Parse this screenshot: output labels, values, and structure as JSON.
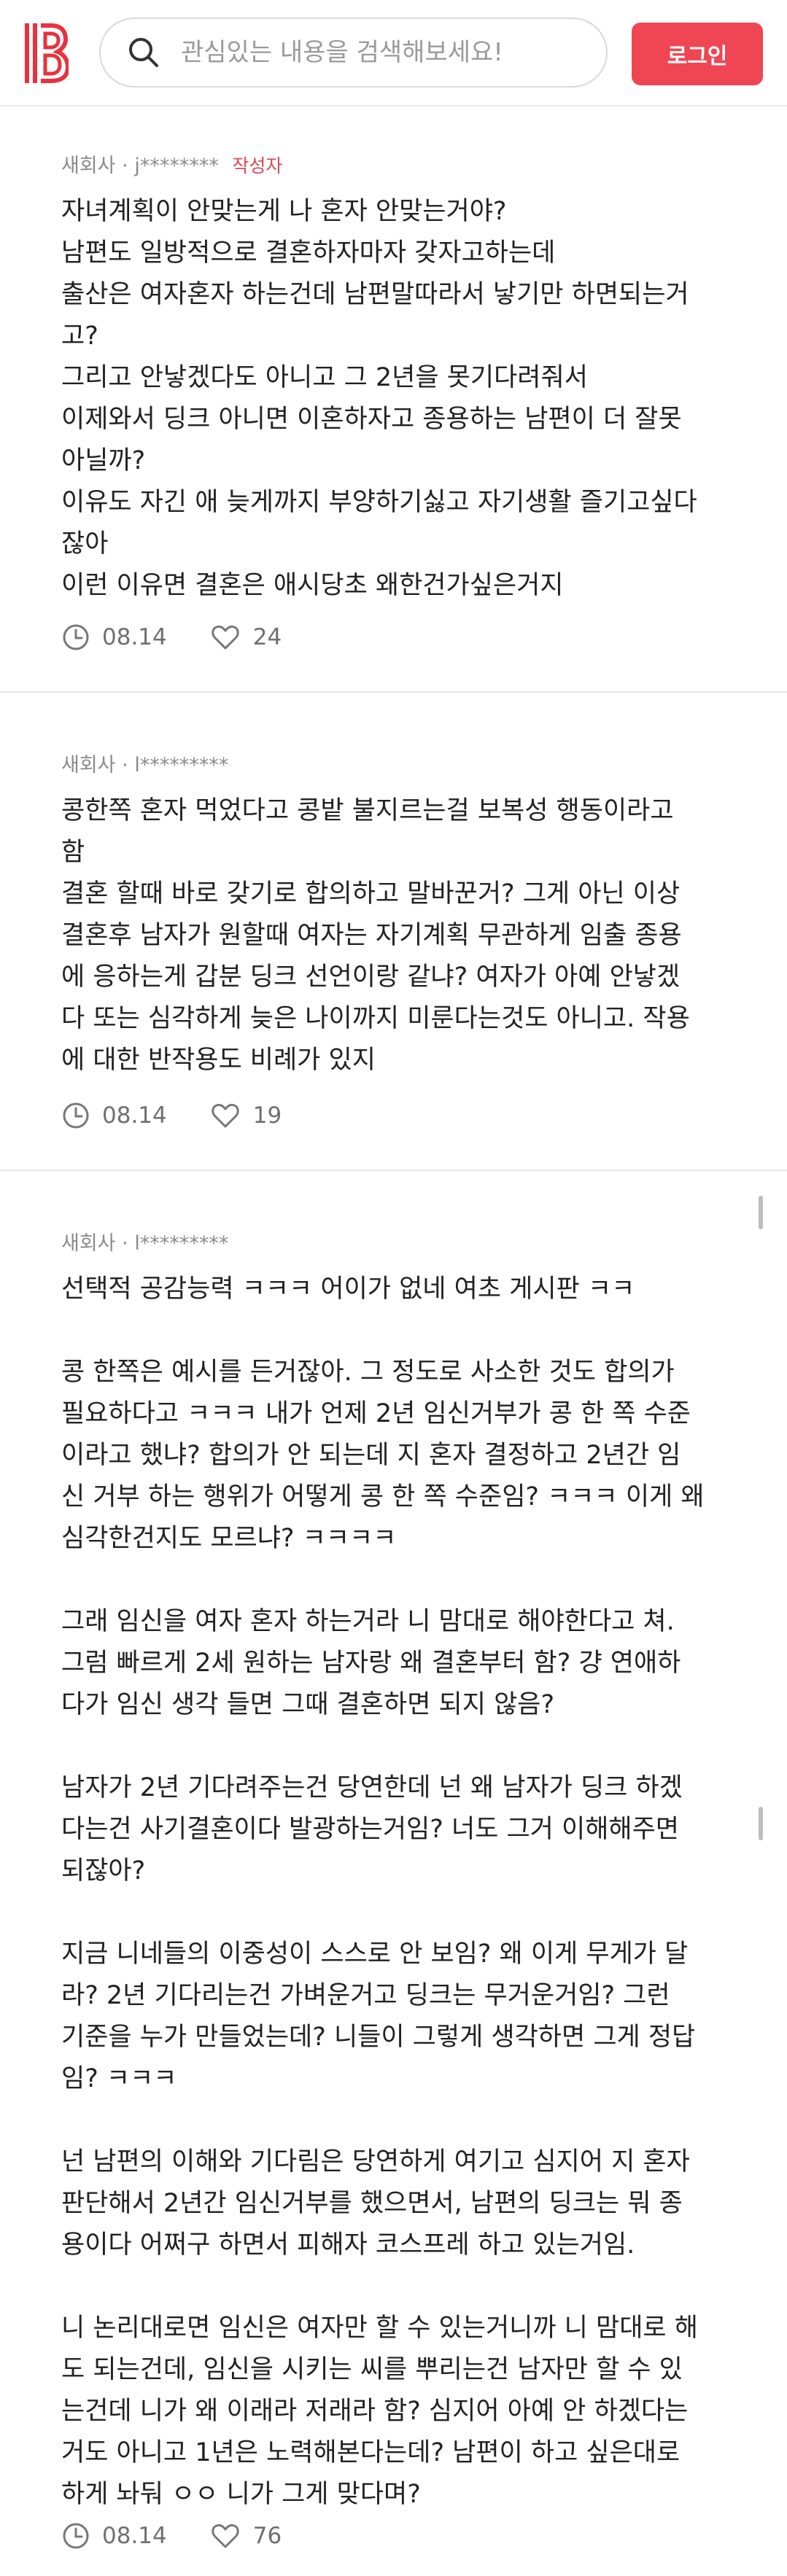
{
  "header": {
    "search_placeholder": "관심있는 내용을 검색해보세요!",
    "login_label": "로그인"
  },
  "comments": [
    {
      "company": "새회사",
      "separator": "·",
      "user": "j********",
      "author_tag": "작성자",
      "lines": [
        "자녀계획이 안맞는게 나 혼자 안맞는거야?",
        "남편도 일방적으로 결혼하자마자 갖자고하는데",
        "출산은 여자혼자 하는건데 남편말따라서 낳기만 하면되는거",
        "고?",
        "그리고 안낳겠다도 아니고 그 2년을 못기다려줘서",
        "이제와서 딩크 아니면 이혼하자고 종용하는 남편이 더 잘못",
        "아닐까?",
        "이유도 자긴 애 늦게까지 부양하기싫고 자기생활 즐기고싶다",
        "잖아",
        "이런 이유면 결혼은 애시당초 왜한건가싶은거지"
      ],
      "date": "08.14",
      "likes": "24"
    },
    {
      "company": "새회사",
      "separator": "·",
      "user": "l*********",
      "lines": [
        "콩한쪽 혼자 먹었다고 콩밭 불지르는걸 보복성 행동이라고",
        "함",
        "결혼 할때 바로 갖기로 합의하고 말바꾼거? 그게 아닌 이상",
        "결혼후 남자가 원할때 여자는 자기계획 무관하게 임출 종용",
        "에 응하는게 갑분 딩크 선언이랑 같냐? 여자가 아예 안낳겠",
        "다 또는 심각하게 늦은 나이까지 미룬다는것도 아니고. 작용",
        "에 대한 반작용도 비례가 있지"
      ],
      "date": "08.14",
      "likes": "19"
    },
    {
      "company": "새회사",
      "separator": "·",
      "user": "l*********",
      "lines": [
        "선택적 공감능력 ㅋㅋㅋ 어이가 없네 여초 게시판 ㅋㅋ",
        "",
        "콩 한쪽은 예시를 든거잖아. 그 정도로 사소한 것도 합의가",
        "필요하다고 ㅋㅋㅋ 내가 언제 2년 임신거부가 콩 한 쪽 수준",
        "이라고 했냐? 합의가 안 되는데 지 혼자 결정하고 2년간 임",
        "신 거부 하는 행위가 어떻게 콩 한 쪽 수준임? ㅋㅋㅋ 이게 왜",
        "심각한건지도 모르냐? ㅋㅋㅋㅋ",
        "",
        "그래 임신을 여자 혼자 하는거라 니 맘대로 해야한다고 쳐.",
        "그럼 빠르게 2세 원하는 남자랑 왜 결혼부터 함? 걍 연애하",
        "다가 임신 생각 들면 그때 결혼하면 되지 않음?",
        "",
        "남자가 2년 기다려주는건 당연한데 넌 왜 남자가 딩크 하겠",
        "다는건 사기결혼이다 발광하는거임? 너도 그거 이해해주면",
        "되잖아?",
        "",
        "지금 니네들의 이중성이 스스로 안 보임? 왜 이게 무게가 달",
        "라? 2년 기다리는건 가벼운거고 딩크는 무거운거임? 그런",
        "기준을 누가 만들었는데? 니들이 그렇게 생각하면 그게 정답",
        "임? ㅋㅋㅋ",
        "",
        "넌 남편의 이해와 기다림은 당연하게 여기고 심지어 지 혼자",
        "판단해서 2년간 임신거부를 했으면서, 남편의 딩크는 뭐 종",
        "용이다 어쩌구 하면서 피해자 코스프레 하고 있는거임.",
        "",
        "니 논리대로면 임신은 여자만 할 수 있는거니까 니 맘대로 해",
        "도 되는건데, 임신을 시키는 씨를 뿌리는건 남자만 할 수 있",
        "는건데 니가 왜 이래라 저래라 함? 심지어 아예 안 하겠다는",
        "거도 아니고 1년은 노력해본다는데? 남편이 하고 싶은대로",
        "하게 놔둬 ㅇㅇ 니가 그게 맞다며?"
      ],
      "date": "08.14",
      "likes": "76"
    }
  ]
}
